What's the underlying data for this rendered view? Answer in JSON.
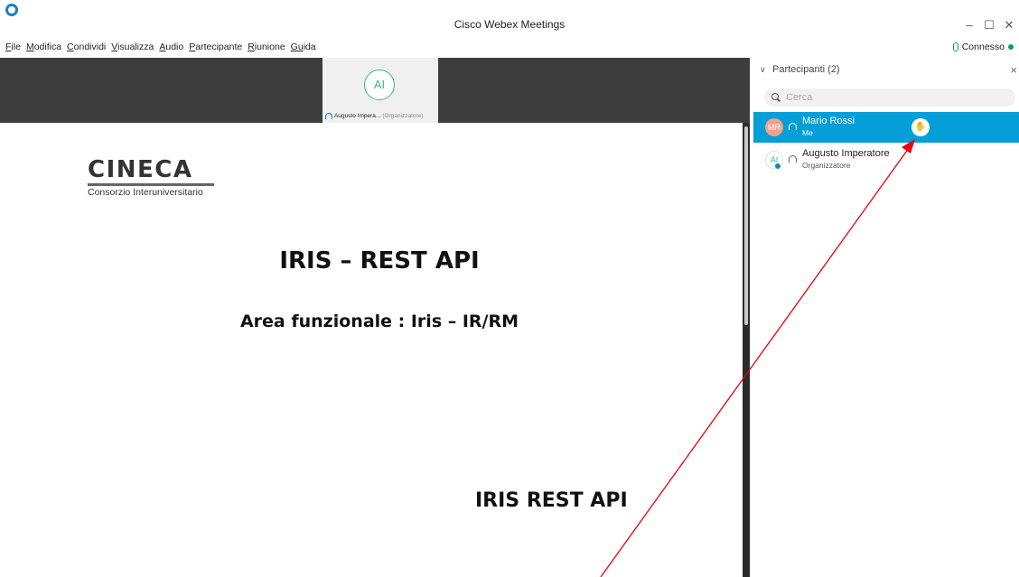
{
  "window": {
    "title": "Cisco Webex Meetings",
    "controls": {
      "minimize": "–",
      "maximize": "☐",
      "close": "✕"
    }
  },
  "menu": {
    "items": [
      {
        "first": "F",
        "rest": "ile"
      },
      {
        "first": "M",
        "rest": "odifica"
      },
      {
        "first": "C",
        "rest": "ondividi"
      },
      {
        "first": "V",
        "rest": "isualizza"
      },
      {
        "first": "A",
        "rest": "udio"
      },
      {
        "first": "P",
        "rest": "artecipante"
      },
      {
        "first": "R",
        "rest": "iunione"
      },
      {
        "first": "Gu",
        "rest": "ida"
      }
    ]
  },
  "connection": {
    "status": "Connesso"
  },
  "thumbnail": {
    "initials": "AI",
    "name": "Augusto Impera...",
    "role": "(Organizzatore)"
  },
  "slide": {
    "logo_word": "CINECA",
    "logo_sub": "Consorzio Interuniversitario",
    "title": "IRIS – REST API",
    "subtitle": "Area funzionale : Iris – IR/RM",
    "footer": "IRIS REST API"
  },
  "participants": {
    "header": "Partecipanti (2)",
    "close": "×",
    "search_placeholder": "Cerca",
    "list": [
      {
        "initials": "MR",
        "name": "Mario Rossi",
        "role": "Me",
        "selected": true
      },
      {
        "initials": "AI",
        "name": "Augusto Imperatore",
        "role": "Organizzatore",
        "selected": false
      }
    ]
  },
  "icons": {
    "app": "webex-logo-icon",
    "raise_hand": "✋",
    "headset": "headset-icon",
    "search": "search-icon"
  },
  "colors": {
    "selection": "#049fd9",
    "annotation": "#e8000b",
    "strip": "#3d3d3d",
    "connected": "#00a650"
  }
}
